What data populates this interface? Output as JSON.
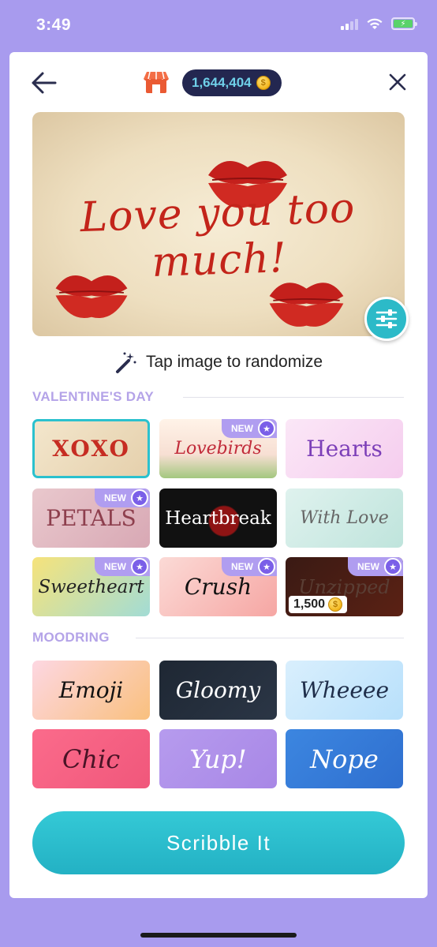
{
  "status": {
    "time": "3:49"
  },
  "header": {
    "coins": "1,644,404",
    "back_icon": "arrow-left-icon",
    "close_icon": "close-icon",
    "store_icon": "store-icon"
  },
  "hero": {
    "text": "Love you too much!"
  },
  "randomize": {
    "label": "Tap image to randomize"
  },
  "sections": {
    "valentines": {
      "title": "VALENTINE'S DAY",
      "tiles": [
        {
          "label": "XOXO",
          "selected": true
        },
        {
          "label": "Lovebirds",
          "badge": "NEW"
        },
        {
          "label": "Hearts"
        },
        {
          "label": "PETALS",
          "badge": "NEW"
        },
        {
          "label": "Heartbreak"
        },
        {
          "label": "With Love"
        },
        {
          "label": "Sweetheart",
          "badge": "NEW"
        },
        {
          "label": "Crush",
          "badge": "NEW"
        },
        {
          "label": "Unzipped",
          "badge": "NEW",
          "price": "1,500"
        }
      ]
    },
    "moodring": {
      "title": "MOODRING",
      "tiles": [
        {
          "label": "Emoji"
        },
        {
          "label": "Gloomy"
        },
        {
          "label": "Wheeee"
        },
        {
          "label": "Chic"
        },
        {
          "label": "Yup!"
        },
        {
          "label": "Nope"
        }
      ]
    }
  },
  "cta": {
    "label": "Scribble It"
  },
  "colors": {
    "background": "#a89bee",
    "accent": "#2bc1ce",
    "section_title": "#b4a3e8",
    "badge": "#b09df0"
  }
}
